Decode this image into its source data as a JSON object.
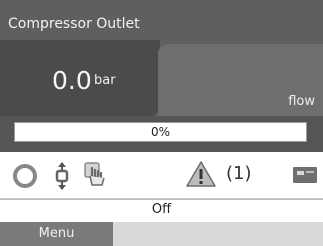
{
  "header": {
    "title": "Compressor Outlet",
    "value": "0.0",
    "unit": "bar",
    "flow_label": "flow"
  },
  "progress": {
    "percent": 0,
    "label": "0%"
  },
  "status": {
    "alarm_count": "(1)",
    "state": "Off"
  },
  "nav": {
    "menu_label": "Menu"
  },
  "icons": {
    "state": "circle-ring-icon",
    "regulation": "pressure-regulation-icon",
    "manual": "hand-control-icon",
    "warning": "warning-triangle-icon",
    "card": "card-reader-icon"
  },
  "colors": {
    "panel": "#5f5f5f",
    "value_box": "#4b4b4b",
    "menu": "#7a7a7a"
  }
}
